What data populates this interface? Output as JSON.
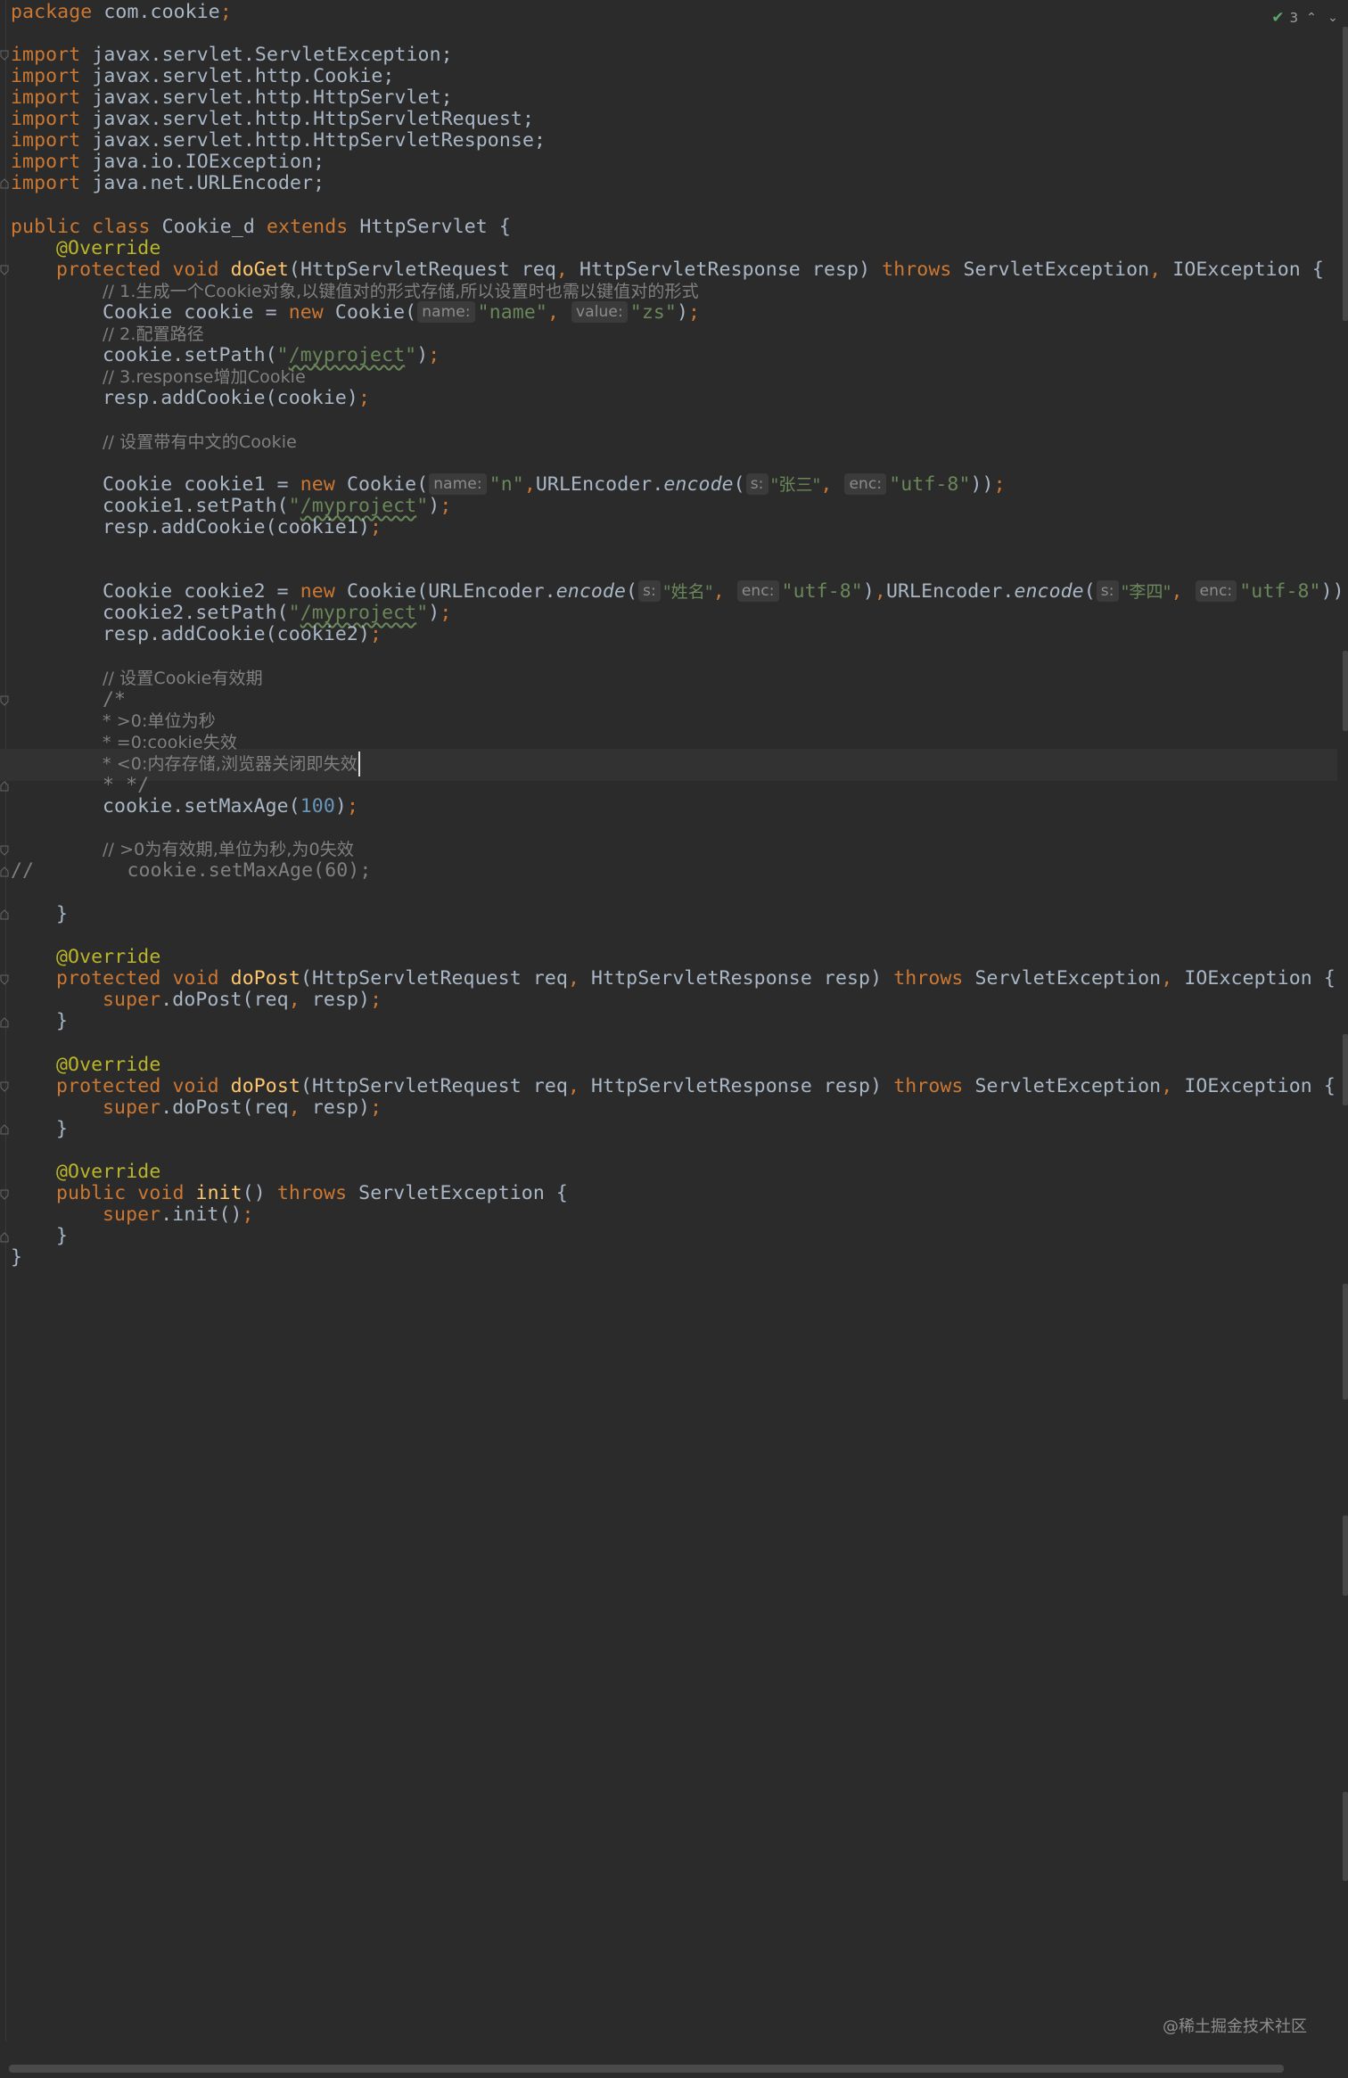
{
  "file": {
    "package_line": "package com.cookie;",
    "imports": [
      "javax.servlet.ServletException;",
      "javax.servlet.http.Cookie;",
      "javax.servlet.http.HttpServlet;",
      "javax.servlet.http.HttpServletRequest;",
      "javax.servlet.http.HttpServletResponse;",
      "java.io.IOException;",
      "java.net.URLEncoder;"
    ],
    "class_name": "Cookie_d",
    "super_class": "HttpServlet",
    "comments": {
      "c1": "// 1.生成一个Cookie对象,以键值对的形式存储,所以设置时也需以键值对的形式",
      "c2": "// 2.配置路径",
      "c3": "// 3.response增加Cookie",
      "c4": "// 设置带有中文的Cookie",
      "c5": "// 设置Cookie有效期",
      "c6": "/*",
      "c7": "* >0:单位为秒",
      "c8": "* =0:cookie失效",
      "c9": "* <0:内存存储,浏览器关闭即失效",
      "c10": "* */",
      "c11": "// >0为有效期,单位为秒,为0失效",
      "c12": "//        cookie.setMaxAge(60);"
    },
    "strings": {
      "name": "\"name\"",
      "zs": "\"zs\"",
      "path": "\"/myproject\"",
      "n": "\"n\"",
      "zhangsan": "\"张三\"",
      "utf8": "\"utf-8\"",
      "xingming": "\"姓名\"",
      "lisi": "\"李四\""
    },
    "hints": {
      "name": "name:",
      "value": "value:",
      "s": "s:",
      "enc": "enc:"
    },
    "max_age": "100"
  },
  "toolbar": {
    "check_icon": "check-icon",
    "count": "3",
    "up_icon": "chevron-up-icon",
    "down_icon": "chevron-down-icon"
  },
  "watermark": "@稀土掘金技术社区"
}
